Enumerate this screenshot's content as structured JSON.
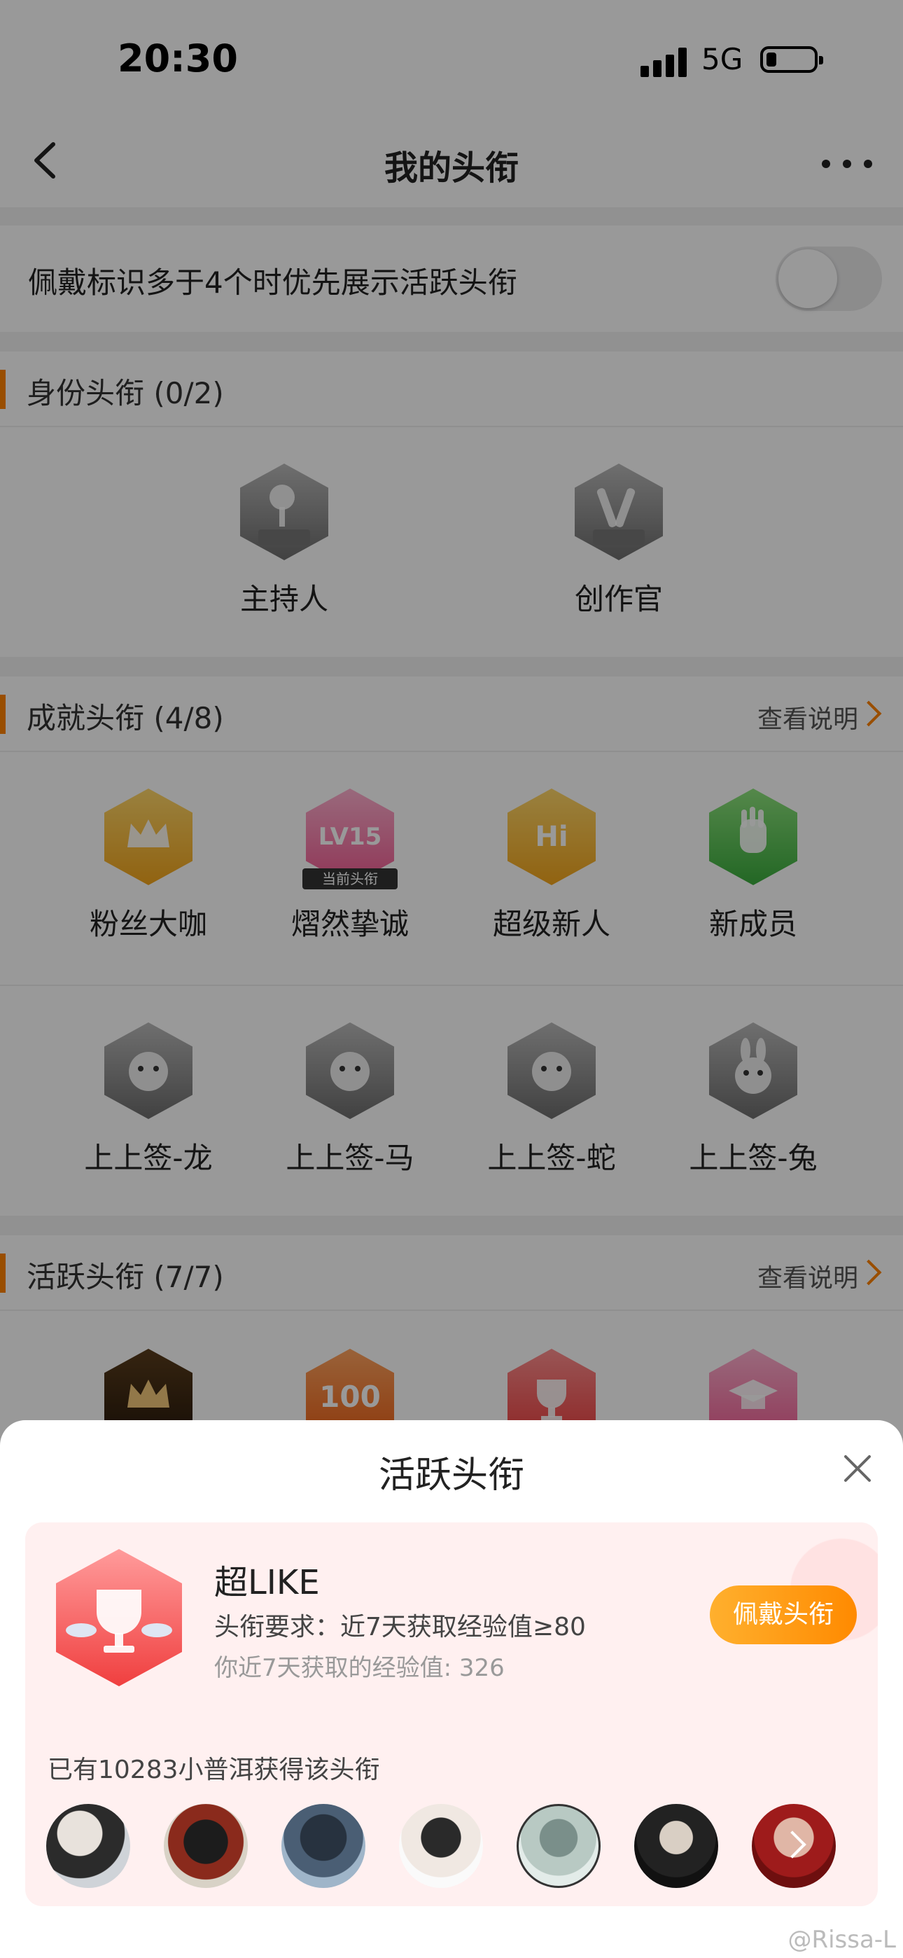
{
  "status_bar": {
    "time": "20:30",
    "network": "5G"
  },
  "nav": {
    "title": "我的头衔"
  },
  "settings": {
    "priority_label": "佩戴标识多于4个时优先展示活跃头衔",
    "priority_on": false
  },
  "identity_section": {
    "title": "身份头衔 (0/2)",
    "badges": [
      {
        "label": "主持人",
        "icon": "microphone-icon",
        "tag": "主持人"
      },
      {
        "label": "创作官",
        "icon": "pen-icon",
        "tag": "创作官"
      }
    ]
  },
  "achievement_section": {
    "title": "成就头衔 (4/8)",
    "link": "查看说明",
    "badges": [
      {
        "label": "粉丝大咖",
        "icon": "crown-icon"
      },
      {
        "label": "熠然挚诚",
        "icon": "lv15-icon",
        "glyph": "LV15",
        "current_tag": "当前头衔"
      },
      {
        "label": "超级新人",
        "icon": "hi-icon",
        "glyph": "Hi"
      },
      {
        "label": "新成员",
        "icon": "hand-icon"
      },
      {
        "label": "上上签-龙",
        "icon": "dragon-icon"
      },
      {
        "label": "上上签-马",
        "icon": "horse-icon"
      },
      {
        "label": "上上签-蛇",
        "icon": "snake-icon"
      },
      {
        "label": "上上签-兔",
        "icon": "rabbit-icon"
      }
    ]
  },
  "active_section": {
    "title": "活跃头衔 (7/7)",
    "link": "查看说明",
    "badges": [
      {
        "icon": "crown-icon"
      },
      {
        "icon": "100-icon",
        "glyph": "100"
      },
      {
        "icon": "trophy-icon"
      },
      {
        "icon": "graduation-cap-icon"
      }
    ]
  },
  "sheet": {
    "title": "活跃头衔",
    "badge_name": "超LIKE",
    "requirement": "头衔要求：近7天获取经验值≥80",
    "my_exp": "你近7天获取的经验值: 326",
    "wear_button": "佩戴头衔",
    "owned_text": "已有10283小普洱获得该头衔",
    "avatar_count": 7
  },
  "watermark": "@Rissa-L",
  "colors": {
    "accent": "#ff8200",
    "button": "#ff9a1a",
    "card_bg": "#fff0f0",
    "badge_red": "#f03f3f"
  }
}
